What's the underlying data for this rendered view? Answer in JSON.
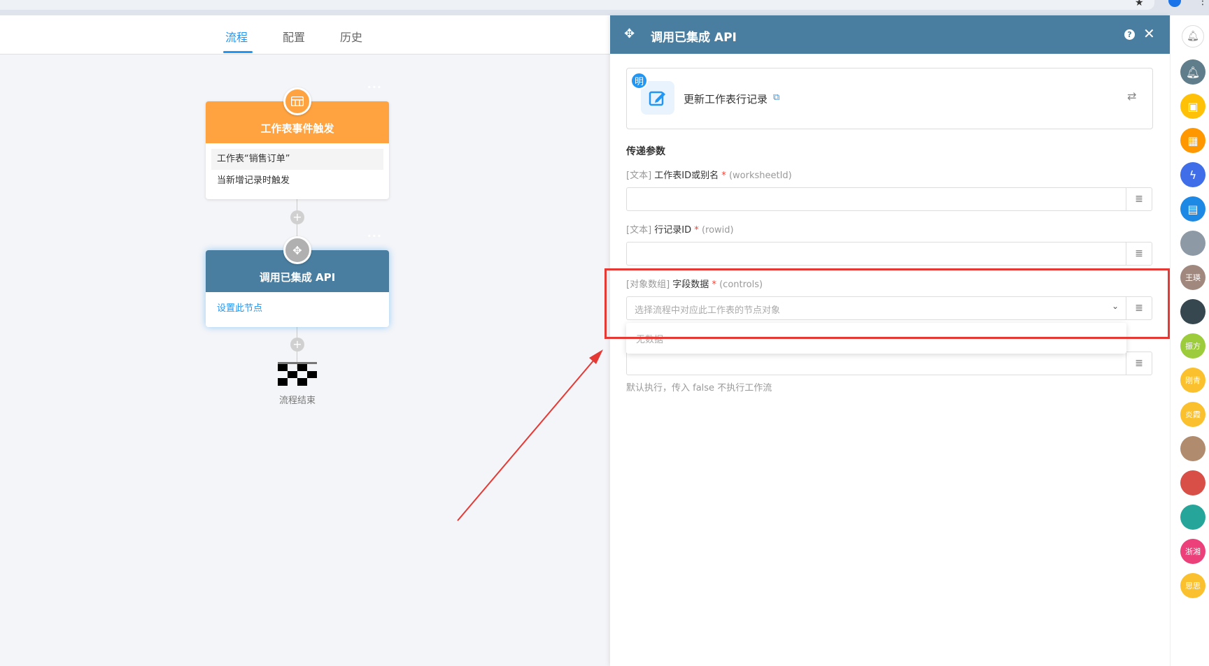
{
  "tabs": [
    {
      "label": "流程",
      "active": true
    },
    {
      "label": "配置",
      "active": false
    },
    {
      "label": "历史",
      "active": false
    }
  ],
  "flow": {
    "trigger_node": {
      "title": "工作表事件触发",
      "worksheet_text": "工作表“销售订单”",
      "event_text": "当新增记录时触发",
      "color": "#ffa340"
    },
    "api_node": {
      "title": "调用已集成 API",
      "link_text": "设置此节点",
      "color": "#4a7ea0"
    },
    "end_label": "流程结束",
    "more_glyph": "···"
  },
  "drawer": {
    "title": "调用已集成 API",
    "action_card": {
      "badge": "明",
      "action_name": "更新工作表行记录"
    },
    "section_title": "传递参数",
    "fields": [
      {
        "type": "[文本]",
        "name": "工作表ID或别名",
        "required": "*",
        "key": "(worksheetId)"
      },
      {
        "type": "[文本]",
        "name": "行记录ID",
        "required": "*",
        "key": "(rowid)"
      },
      {
        "type": "[对象数组]",
        "name": "字段数据",
        "required": "*",
        "key": "(controls)",
        "placeholder": "选择流程中对应此工作表的节点对象"
      }
    ],
    "dropdown_empty": "无数据",
    "hint": "默认执行，传入 false 不执行工作流"
  },
  "rail": {
    "items": [
      {
        "kind": "bell-icon",
        "color": "#607d8b"
      },
      {
        "kind": "app-cube-icon",
        "color": "#ffc107"
      },
      {
        "kind": "grid-icon",
        "color": "#ff9800"
      },
      {
        "kind": "lightning-icon",
        "color": "#3f6ee8"
      },
      {
        "kind": "chat-icon",
        "color": "#1e88e5"
      },
      {
        "kind": "avatar",
        "color": "#8d9aa6"
      },
      {
        "kind": "avatar",
        "label": "王瑛",
        "color": "#a1887f"
      },
      {
        "kind": "avatar",
        "color": "#37474f"
      },
      {
        "kind": "avatar",
        "label": "振方",
        "color": "#9ccc3c"
      },
      {
        "kind": "avatar",
        "label": "刚青",
        "color": "#fbc02d"
      },
      {
        "kind": "avatar",
        "label": "炎霞",
        "color": "#fbc02d"
      },
      {
        "kind": "avatar",
        "color": "#b08b6e"
      },
      {
        "kind": "avatar",
        "color": "#d84f47"
      },
      {
        "kind": "avatar",
        "color": "#26a69a"
      },
      {
        "kind": "avatar",
        "label": "浙湘",
        "color": "#ec407a"
      },
      {
        "kind": "avatar",
        "label": "思思",
        "color": "#fbc02d"
      }
    ]
  }
}
